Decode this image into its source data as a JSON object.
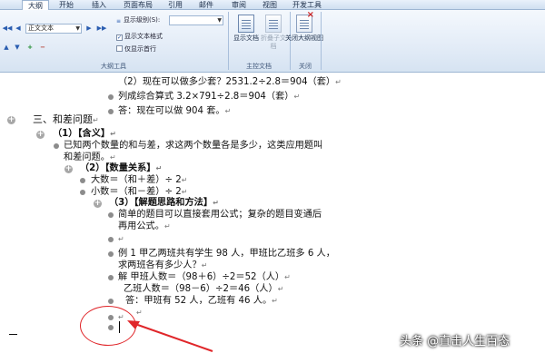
{
  "tabs": [
    {
      "label": "大纲",
      "active": true
    },
    {
      "label": "开始",
      "active": false
    },
    {
      "label": "插入",
      "active": false
    },
    {
      "label": "页面布局",
      "active": false
    },
    {
      "label": "引用",
      "active": false
    },
    {
      "label": "邮件",
      "active": false
    },
    {
      "label": "审阅",
      "active": false
    },
    {
      "label": "视图",
      "active": false
    },
    {
      "label": "开发工具",
      "active": false
    }
  ],
  "ribbon": {
    "level_combo_value": "正文文本",
    "show_level_label": "显示级别(S):",
    "show_text_format": "显示文本格式",
    "show_first_line_only": "仅显示首行",
    "outline_tools_label": "大纲工具",
    "master_doc_label": "主控文档",
    "close_group_label": "关闭",
    "show_doc_btn": "显示文档",
    "fold_subdoc_btn": "折叠子文档",
    "close_outline_btn": "关闭大纲视图"
  },
  "document": {
    "l1": "（2）现在可以做多少套？2531.2÷2.8＝904（套）",
    "l2": "列成综合算式 3.2×791÷2.8＝904（套）",
    "l3": "答：现在可以做 904 套。",
    "l4": "三、和差问题",
    "l5": "（1）【含义】",
    "l6": "已知两个数量的和与差，求这两个数量各是多少，这类应用题叫",
    "l7": "和差问题。",
    "l8": "（2）【数量关系】",
    "l9": "大数＝（和＋差）÷ 2",
    "l10": "小数＝（和－差）÷ 2",
    "l11": "（3）【解题思路和方法】",
    "l12": "简单的题目可以直接套用公式；复杂的题目变通后",
    "l13": "再用公式。",
    "l14": "例 1 甲乙两班共有学生 98 人，甲班比乙班多 6 人，",
    "l15": "求两班各有多少人？",
    "l16": "解  甲班人数＝（98＋6）÷2＝52（人）",
    "l17": "乙班人数＝（98－6）÷2＝46（人）",
    "l18": "答：甲班有 52 人，乙班有 46 人。",
    "para_mark": "↵"
  },
  "watermark": "头条 @直击人生百态",
  "colors": {
    "annotation": "#e0262a",
    "ribbon_accent": "#9db5d2"
  }
}
